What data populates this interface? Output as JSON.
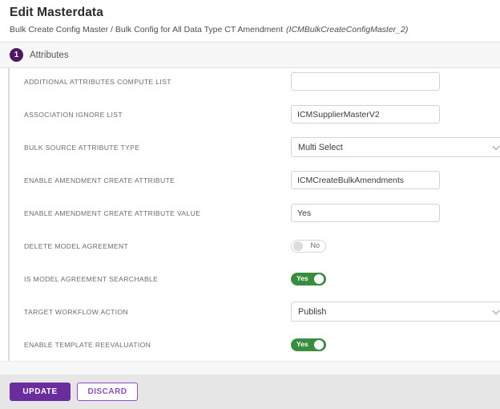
{
  "header": {
    "title": "Edit Masterdata",
    "breadcrumb": "Bulk Create Config Master / Bulk Config for All Data Type CT Amendment",
    "breadcrumb_code": "(ICMBulkCreateConfigMaster_2)"
  },
  "step": {
    "number": "1",
    "label": "Attributes"
  },
  "form": {
    "fields": [
      {
        "label": "ADDITIONAL ATTRIBUTES COMPUTE LIST",
        "type": "text",
        "value": "",
        "placeholder": ""
      },
      {
        "label": "ASSOCIATION IGNORE LIST",
        "type": "text",
        "value": "ICMSupplierMasterV2",
        "placeholder": ""
      },
      {
        "label": "BULK SOURCE ATTRIBUTE TYPE",
        "type": "select",
        "value": "Multi Select"
      },
      {
        "label": "ENABLE AMENDMENT CREATE ATTRIBUTE",
        "type": "text",
        "value": "ICMCreateBulkAmendments",
        "placeholder": ""
      },
      {
        "label": "ENABLE AMENDMENT CREATE ATTRIBUTE VALUE",
        "type": "text",
        "value": "Yes",
        "placeholder": ""
      },
      {
        "label": "DELETE MODEL AGREEMENT",
        "type": "toggle",
        "state": "off",
        "value": "No"
      },
      {
        "label": "IS MODEL AGREEMENT SEARCHABLE",
        "type": "toggle",
        "state": "on",
        "value": "Yes"
      },
      {
        "label": "TARGET WORKFLOW ACTION",
        "type": "select",
        "value": "Publish"
      },
      {
        "label": "ENABLE TEMPLATE REEVALUATION",
        "type": "toggle",
        "state": "on",
        "value": "Yes"
      }
    ]
  },
  "footer": {
    "update_label": "UPDATE",
    "discard_label": "DISCARD"
  },
  "colors": {
    "primary_purple": "#6b2d9e",
    "badge_purple": "#4b1863",
    "toggle_on_green": "#3a8c3f",
    "secondary_text": "#6b6b70"
  }
}
